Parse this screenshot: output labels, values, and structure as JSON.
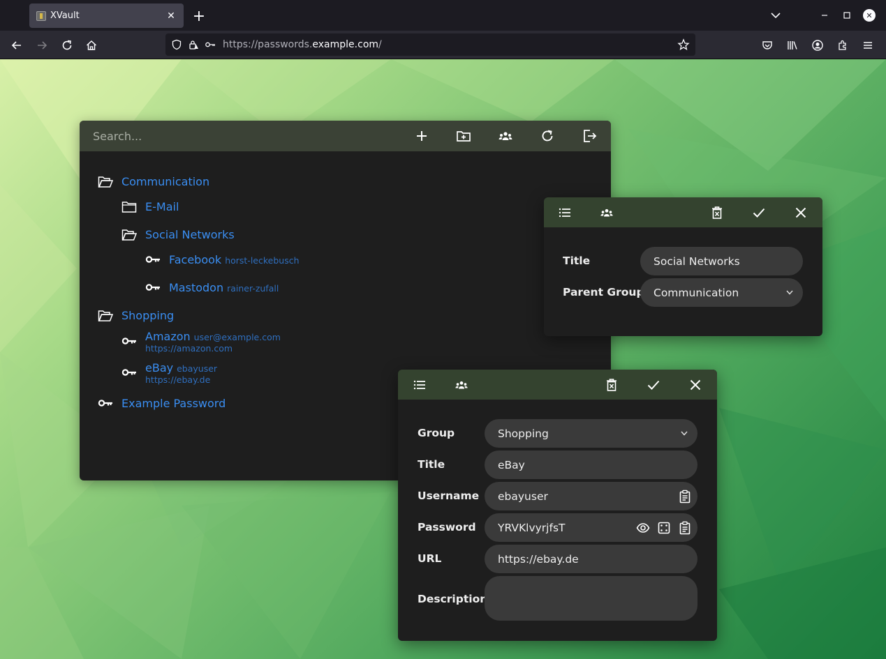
{
  "browser": {
    "tab_title": "XVault",
    "url_prefix": "https://passwords.",
    "url_domain": "example.com",
    "url_suffix": "/"
  },
  "main": {
    "search_placeholder": "Search...",
    "tree": [
      {
        "label": "Communication",
        "type": "group"
      },
      {
        "label": "E-Mail",
        "type": "group"
      },
      {
        "label": "Social Networks",
        "type": "group"
      },
      {
        "label": "Facebook",
        "username": "horst-leckebusch",
        "type": "entry"
      },
      {
        "label": "Mastodon",
        "username": "rainer-zufall",
        "type": "entry"
      },
      {
        "label": "Shopping",
        "type": "group"
      },
      {
        "label": "Amazon",
        "username": "user@example.com",
        "url": "https://amazon.com",
        "type": "entry"
      },
      {
        "label": "eBay",
        "username": "ebayuser",
        "url": "https://ebay.de",
        "type": "entry"
      },
      {
        "label": "Example Password",
        "type": "entry"
      }
    ]
  },
  "group_dialog": {
    "title_label": "Title",
    "title_value": "Social Networks",
    "parent_label": "Parent Group",
    "parent_value": "Communication"
  },
  "entry_dialog": {
    "group_label": "Group",
    "group_value": "Shopping",
    "title_label": "Title",
    "title_value": "eBay",
    "username_label": "Username",
    "username_value": "ebayuser",
    "password_label": "Password",
    "password_value": "YRVKlvyrjfsT",
    "url_label": "URL",
    "url_value": "https://ebay.de",
    "description_label": "Description",
    "description_value": ""
  },
  "colors": {
    "link": "#3a8ef2",
    "toolbar_main": "#3b4236",
    "toolbar_dialog": "#34432f",
    "panel_bg": "#1e1e1e",
    "field_bg": "#3a3a3a"
  }
}
